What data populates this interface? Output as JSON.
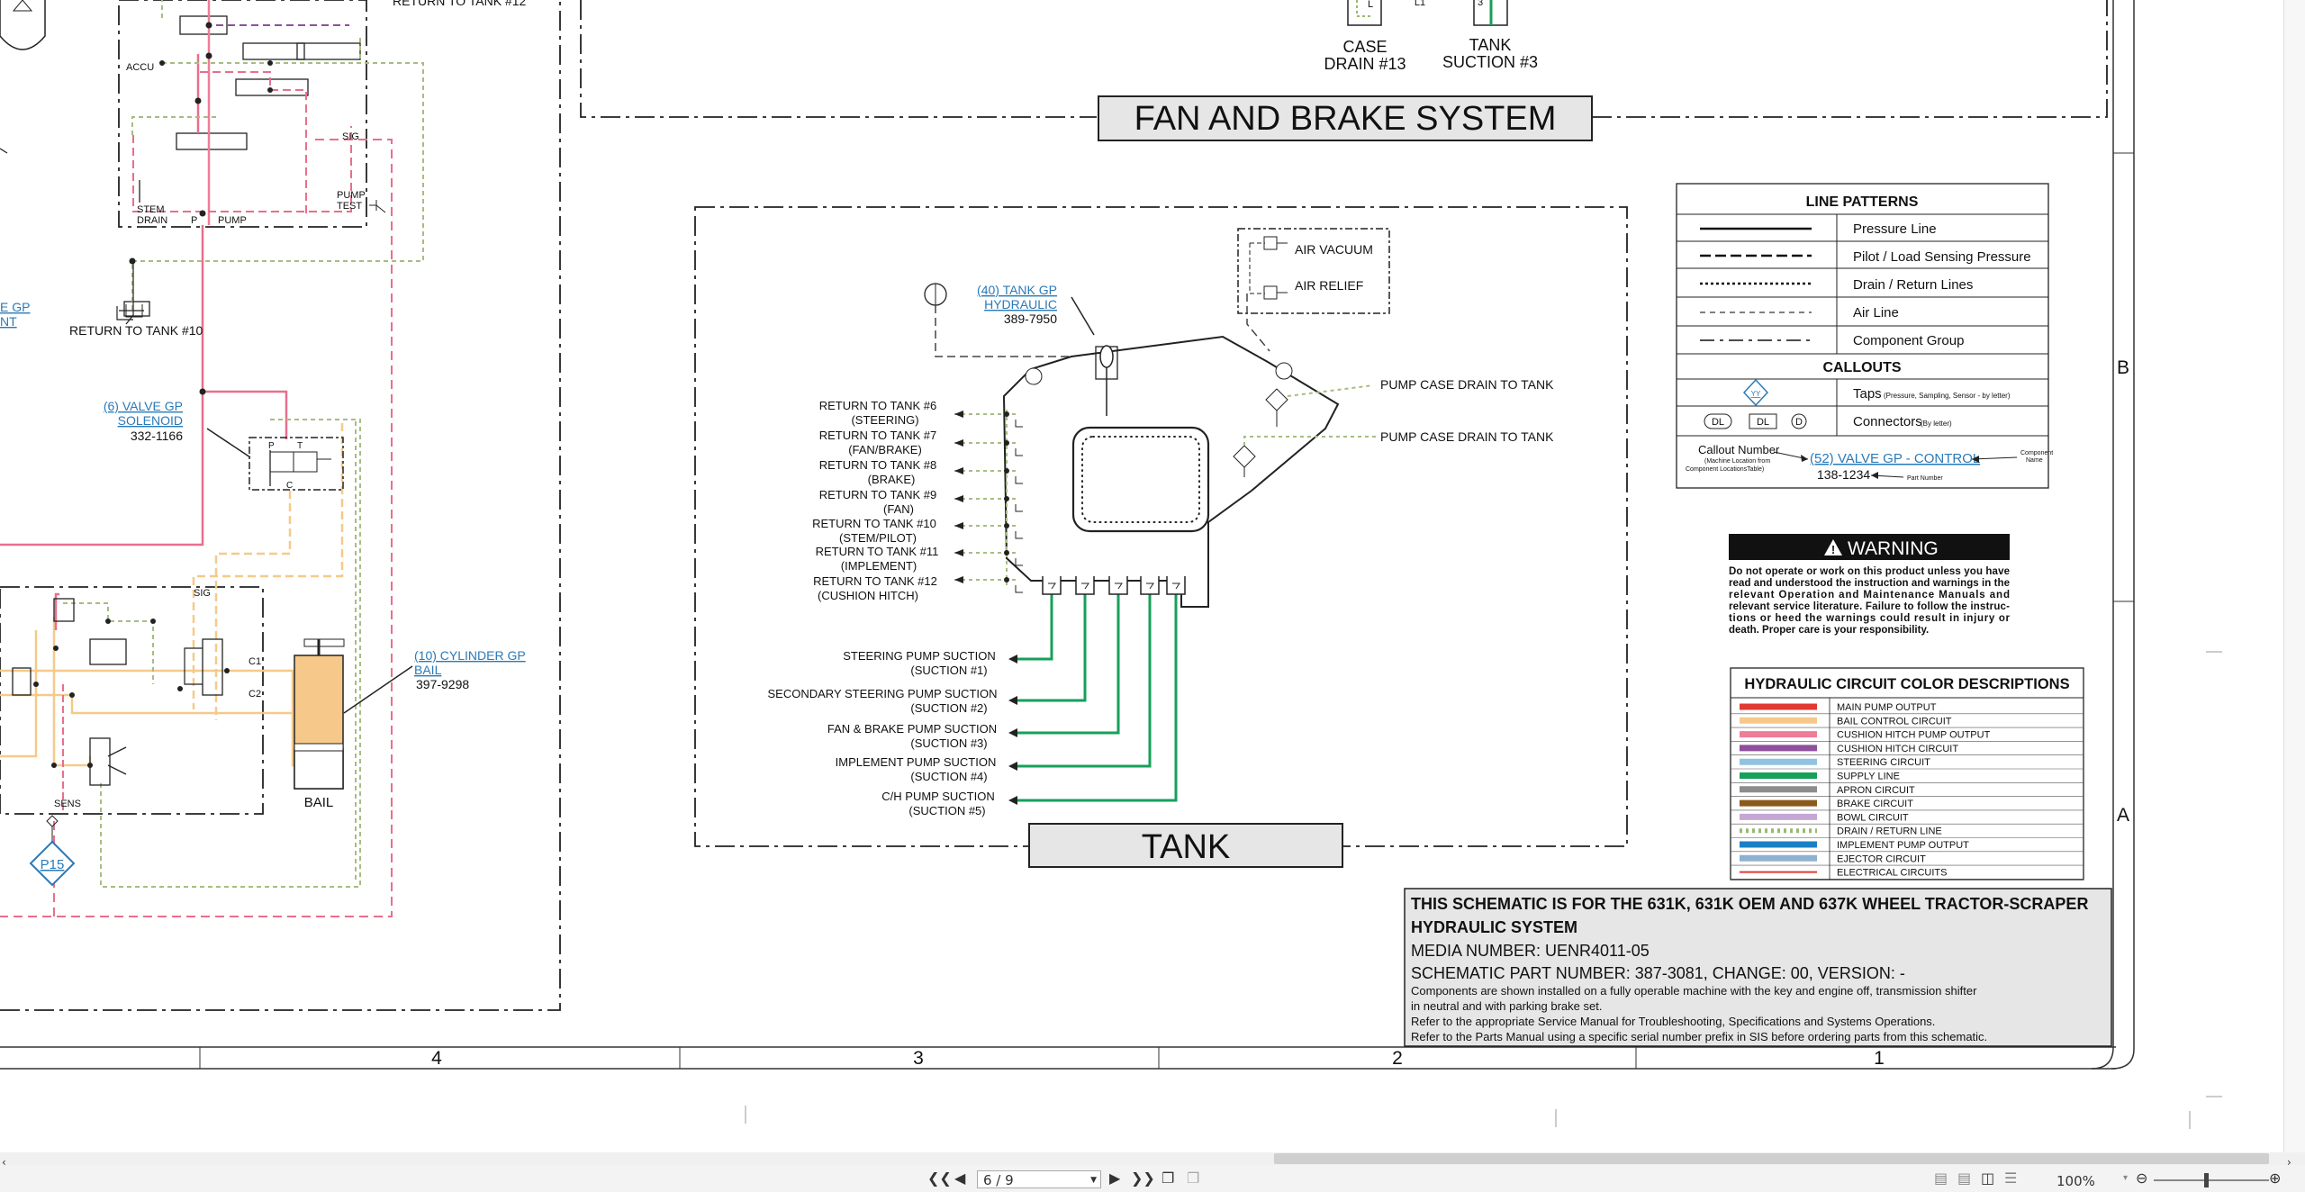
{
  "titles": {
    "fan_brake": "FAN AND BRAKE SYSTEM",
    "tank": "TANK",
    "bail": "BAIL"
  },
  "top_labels": {
    "case_drain": "CASE",
    "case_drain2": "DRAIN #13",
    "tank_suction": "TANK",
    "tank_suction2": "SUCTION #3",
    "return12_top": "RETURN TO TANK #12",
    "l1": "L1",
    "l": "L",
    "three": "3"
  },
  "left_labels": {
    "accu": "ACCU",
    "sig": "SIG",
    "stem": "STEM",
    "drain": "DRAIN",
    "p": "P",
    "pump": "PUMP",
    "pump2": "PUMP",
    "test": "TEST",
    "return10": "RETURN TO TANK #10",
    "egp": "E GP",
    "nt": "NT",
    "sig2": "SIG",
    "c1": "C1",
    "c2": "C2",
    "sens": "SENS",
    "p15": "P15"
  },
  "valve_gp": {
    "callout": "(6) VALVE GP",
    "name": "SOLENOID",
    "part": "332-1166",
    "p": "P",
    "t": "T",
    "c": "C"
  },
  "cylinder_gp": {
    "callout": "(10) CYLINDER GP",
    "name": "BAIL",
    "part": "397-9298"
  },
  "tank_gp": {
    "callout": "(40) TANK GP",
    "name": "HYDRAULIC",
    "part": "389-7950"
  },
  "air": {
    "vacuum": "AIR VACUUM",
    "relief": "AIR RELIEF"
  },
  "pump_case": [
    "PUMP CASE DRAIN TO TANK",
    "PUMP CASE DRAIN TO TANK"
  ],
  "returns": [
    [
      "RETURN TO TANK #6",
      "(STEERING)"
    ],
    [
      "RETURN TO TANK #7",
      "(FAN/BRAKE)"
    ],
    [
      "RETURN TO TANK #8",
      "(BRAKE)"
    ],
    [
      "RETURN TO TANK #9",
      "(FAN)"
    ],
    [
      "RETURN TO TANK #10",
      "(STEM/PILOT)"
    ],
    [
      "RETURN TO TANK #11",
      "(IMPLEMENT)"
    ],
    [
      "RETURN TO TANK #12",
      "(CUSHION HITCH)"
    ]
  ],
  "suctions": [
    [
      "STEERING PUMP SUCTION",
      "(SUCTION #1)"
    ],
    [
      "SECONDARY STEERING PUMP SUCTION",
      "(SUCTION #2)"
    ],
    [
      "FAN & BRAKE PUMP SUCTION",
      "(SUCTION #3)"
    ],
    [
      "IMPLEMENT PUMP SUCTION",
      "(SUCTION #4)"
    ],
    [
      "C/H PUMP SUCTION",
      "(SUCTION #5)"
    ]
  ],
  "legend": {
    "line_patterns_title": "LINE PATTERNS",
    "patterns": [
      "Pressure Line",
      "Pilot / Load Sensing Pressure",
      "Drain / Return Lines",
      "Air Line",
      "Component Group"
    ],
    "callouts_title": "CALLOUTS",
    "taps": "Taps",
    "taps_note": "(Pressure, Sampling, Sensor - by letter)",
    "tap_glyph": "YY",
    "connectors": "Connectors",
    "connectors_note": "(By letter)",
    "conn_dl1": "DL",
    "conn_dl2": "DL",
    "conn_d": "D",
    "callout_number": "Callout Number",
    "callout_number_note1": "(Machine Location from",
    "callout_number_note2": "Component LocationsTable)",
    "callout_example": "(52) VALVE GP - CONTROL",
    "component_name1": "Component",
    "component_name2": "Name",
    "part_example": "138-1234",
    "part_number_note": "Part Number"
  },
  "warning": {
    "title": "WARNING",
    "lines": [
      "Do not operate or work on this product unless you have",
      "read and understood the instruction and warnings in the",
      "relevant Operation and Maintenance Manuals and",
      "relevant service literature. Failure to follow the instruc-",
      "tions or heed the warnings could result in injury or",
      "death. Proper care is your responsibility."
    ]
  },
  "color_desc": {
    "title": "HYDRAULIC CIRCUIT COLOR DESCRIPTIONS",
    "items": [
      {
        "label": "MAIN PUMP OUTPUT",
        "color": "#e03a33",
        "style": "solid"
      },
      {
        "label": "BAIL CONTROL CIRCUIT",
        "color": "#f6c98a",
        "style": "solid"
      },
      {
        "label": "CUSHION HITCH PUMP OUTPUT",
        "color": "#ee7d97",
        "style": "solid"
      },
      {
        "label": "CUSHION HITCH CIRCUIT",
        "color": "#8e4f9b",
        "style": "solid"
      },
      {
        "label": "STEERING CIRCUIT",
        "color": "#8fc3df",
        "style": "solid"
      },
      {
        "label": "SUPPLY LINE",
        "color": "#16a05a",
        "style": "solid"
      },
      {
        "label": "APRON CIRCUIT",
        "color": "#8c8c8c",
        "style": "solid"
      },
      {
        "label": "BRAKE CIRCUIT",
        "color": "#8a5a1c",
        "style": "solid"
      },
      {
        "label": "BOWL CIRCUIT",
        "color": "#c4a7d4",
        "style": "solid"
      },
      {
        "label": "DRAIN / RETURN LINE",
        "color": "#9ab870",
        "style": "dotted"
      },
      {
        "label": "IMPLEMENT PUMP OUTPUT",
        "color": "#1a80c4",
        "style": "solid"
      },
      {
        "label": "EJECTOR CIRCUIT",
        "color": "#8fb0cf",
        "style": "solid"
      },
      {
        "label": "ELECTRICAL CIRCUITS",
        "color": "#e03a33",
        "style": "thin"
      }
    ]
  },
  "info": {
    "line1": "THIS SCHEMATIC IS FOR THE 631K, 631K OEM AND 637K WHEEL TRACTOR-SCRAPER",
    "line2": "HYDRAULIC SYSTEM",
    "media": "MEDIA NUMBER: UENR4011-05",
    "part": "SCHEMATIC PART NUMBER: 387-3081, CHANGE: 00, VERSION: -",
    "notes": [
      "Components are shown installed on a fully operable machine with the key and engine off, transmission shifter",
      "in neutral and with parking brake set.",
      "Refer to the appropriate Service Manual for Troubleshooting, Specifications and Systems Operations.",
      "Refer to the Parts Manual using a specific serial number prefix in SIS before ordering parts from this schematic."
    ]
  },
  "grid": {
    "cols": [
      "4",
      "3",
      "2",
      "1"
    ],
    "rows": [
      "B",
      "A"
    ]
  },
  "toolbar": {
    "page": "6 / 9",
    "zoom": "100%"
  },
  "colors": {
    "pink": "#e86f8c",
    "pink_dash": "#ee8fa7",
    "orange": "#f6c98a",
    "green": "#16a05a",
    "drain": "#a6bd82",
    "purple": "#8e4f9b",
    "link": "#2a7ab8"
  }
}
